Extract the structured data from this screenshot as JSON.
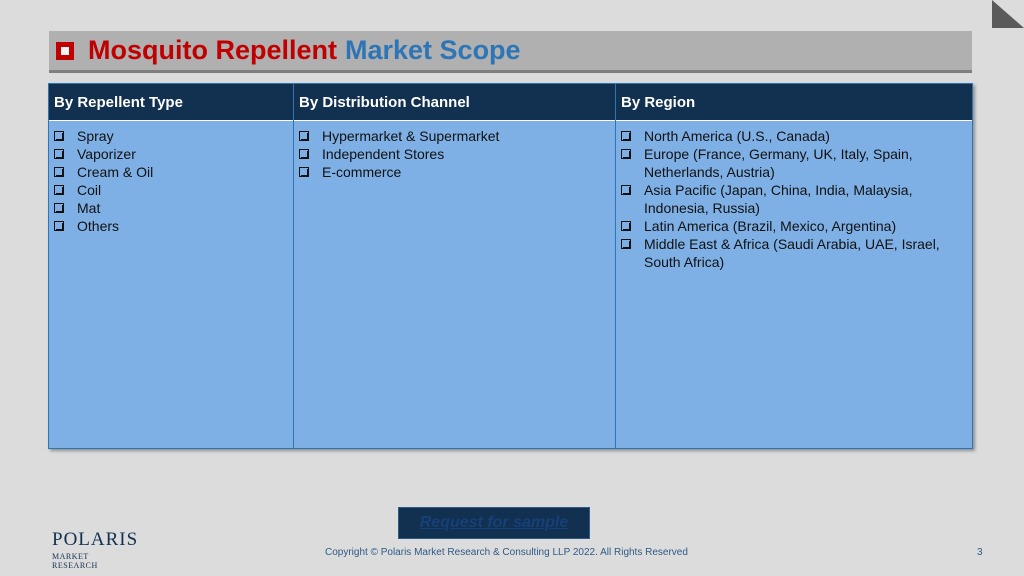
{
  "title": {
    "part1": "Mosquito Repellent",
    "part2": "Market Scope"
  },
  "columns": [
    {
      "header": "By Repellent Type",
      "items": [
        "Spray",
        "Vaporizer",
        "Cream & Oil",
        "Coil",
        "Mat",
        "Others"
      ]
    },
    {
      "header": "By Distribution Channel",
      "items": [
        "Hypermarket & Supermarket",
        "Independent Stores",
        "E-commerce"
      ]
    },
    {
      "header": "By Region",
      "items": [
        "North America (U.S., Canada)",
        "Europe (France, Germany, UK, Italy, Spain, Netherlands, Austria)",
        "Asia Pacific (Japan, China, India, Malaysia, Indonesia, Russia)",
        "Latin America (Brazil, Mexico, Argentina)",
        "Middle East & Africa (Saudi Arabia, UAE, Israel, South Africa)"
      ]
    }
  ],
  "request_button": "Request for sample",
  "logo": {
    "main": "POLARIS",
    "sub": "MARKET RESEARCH"
  },
  "footer": {
    "copyright": "Copyright © Polaris Market Research & Consulting LLP 2022. All Rights Reserved",
    "page_number": "3"
  },
  "colors": {
    "title_red": "#c00000",
    "title_blue": "#2e75b6",
    "header_bg": "#12304f",
    "body_bg": "#7eb0e6"
  }
}
